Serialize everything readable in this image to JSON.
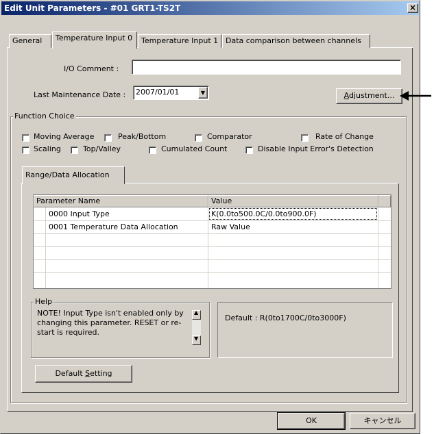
{
  "window": {
    "title": "Edit Unit Parameters - #01 GRT1-TS2T",
    "close_glyph": "×"
  },
  "tabs": [
    {
      "label": "General"
    },
    {
      "label": "Temperature Input 0"
    },
    {
      "label": "Temperature Input 1"
    },
    {
      "label": "Data comparison between channels"
    }
  ],
  "form": {
    "io_comment_label": "I/O Comment :",
    "io_comment_value": "",
    "maintenance_label": "Last Maintenance Date :",
    "maintenance_value": "2007/01/01",
    "adjustment_label_pre": "",
    "adjustment_label_key": "A",
    "adjustment_label_post": "djustment..."
  },
  "function_choice": {
    "title": "Function Choice",
    "options": [
      {
        "label": "Moving Average",
        "checked": false
      },
      {
        "label": "Peak/Bottom",
        "checked": false
      },
      {
        "label": "Comparator",
        "checked": false
      },
      {
        "label": "Rate of Change",
        "checked": false
      },
      {
        "label": "Scaling",
        "checked": false
      },
      {
        "label": "Top/Valley",
        "checked": false
      },
      {
        "label": "Cumulated Count",
        "checked": false
      },
      {
        "label": "Disable Input Error's Detection",
        "checked": false
      }
    ]
  },
  "inner_tab": {
    "label": "Range/Data Allocation"
  },
  "grid": {
    "headers": [
      "Parameter Name",
      "Value"
    ],
    "rows": [
      {
        "name": "0000 Input Type",
        "value": "K(0.0to500.0C/0.0to900.0F)"
      },
      {
        "name": "0001 Temperature Data Allocation",
        "value": "Raw Value"
      }
    ]
  },
  "help": {
    "title": "Help",
    "text": "NOTE! Input Type isn't enabled only by changing this parameter. RESET or re-start is required.",
    "default_text": "Default : R(0to1700C/0to3000F)"
  },
  "default_setting": {
    "pre": "Default ",
    "key": "S",
    "post": "etting"
  },
  "footer": {
    "ok_label": "OK",
    "cancel_label": "キャンセル"
  }
}
